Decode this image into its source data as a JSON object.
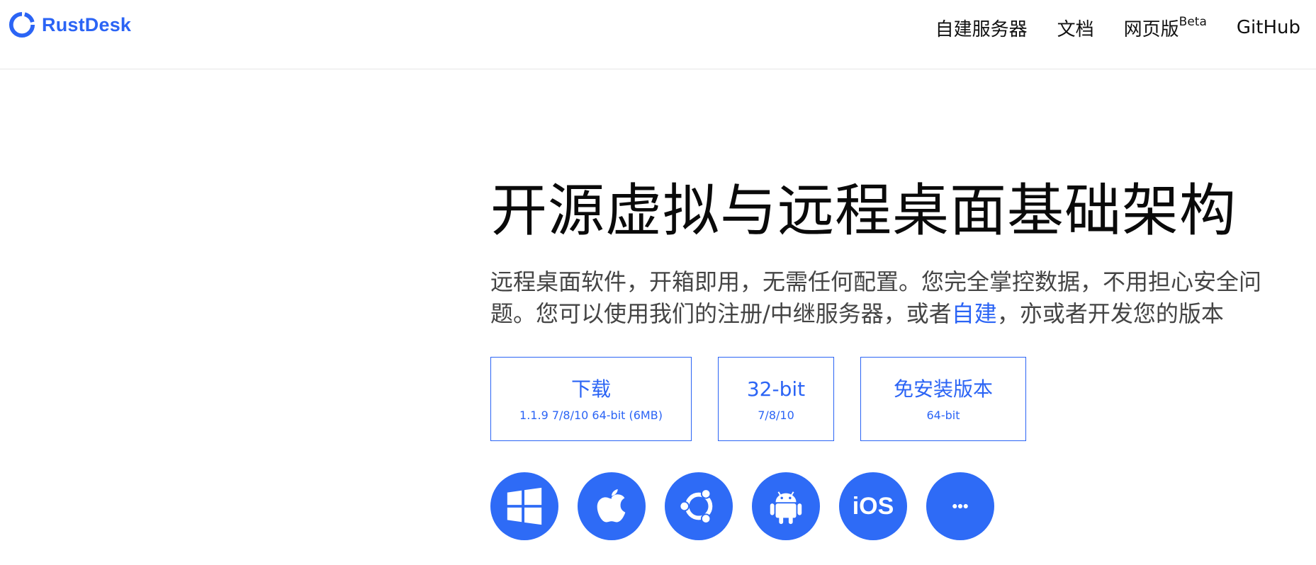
{
  "header": {
    "logo_text": "RustDesk",
    "nav": {
      "self_host": "自建服务器",
      "docs": "文档",
      "web": "网页版",
      "web_badge": "Beta",
      "github": "GitHub"
    }
  },
  "hero": {
    "title": "开源虚拟与远程桌面基础架构",
    "desc_part1": "远程桌面软件，开箱即用，无需任何配置。您完全掌控数据，不用担心安全问题。您可以使用我们的注册/中继服务器，或者",
    "desc_link": "自建",
    "desc_part2": "，亦或者开发您的版本"
  },
  "downloads": [
    {
      "label": "下载",
      "sub": "1.1.9 7/8/10 64-bit (6MB)"
    },
    {
      "label": "32-bit",
      "sub": "7/8/10"
    },
    {
      "label": "免安装版本",
      "sub": "64-bit"
    }
  ],
  "platforms": {
    "icons": [
      "windows-icon",
      "apple-icon",
      "ubuntu-icon",
      "android-icon",
      "ios-icon",
      "more-icon"
    ],
    "ios_label": "iOS"
  },
  "colors": {
    "accent": "#2b64f5",
    "platform_bg": "#2e6bf6"
  }
}
